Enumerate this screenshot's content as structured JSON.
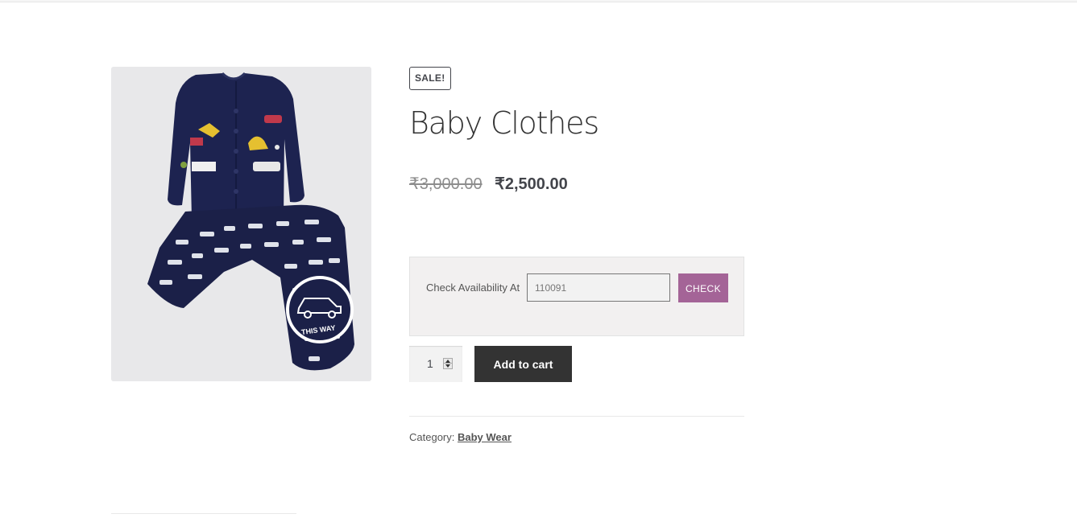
{
  "product": {
    "sale_badge": "SALE!",
    "title": "Baby Clothes",
    "price_old": "₹3,000.00",
    "price_new": "₹2,500.00",
    "image_icon": "product-photo-baby-clothes",
    "image_caption_text": "THIS WAY"
  },
  "availability": {
    "label": "Check Availability At",
    "pincode_value": "110091",
    "check_label": "CHECK"
  },
  "cart": {
    "quantity": "1",
    "add_to_cart_label": "Add to cart"
  },
  "meta": {
    "category_label": "Category:",
    "category_value": "Baby Wear"
  },
  "colors": {
    "accent": "#a46497",
    "button_dark": "#333333",
    "availability_bg": "#f2f0f0"
  }
}
